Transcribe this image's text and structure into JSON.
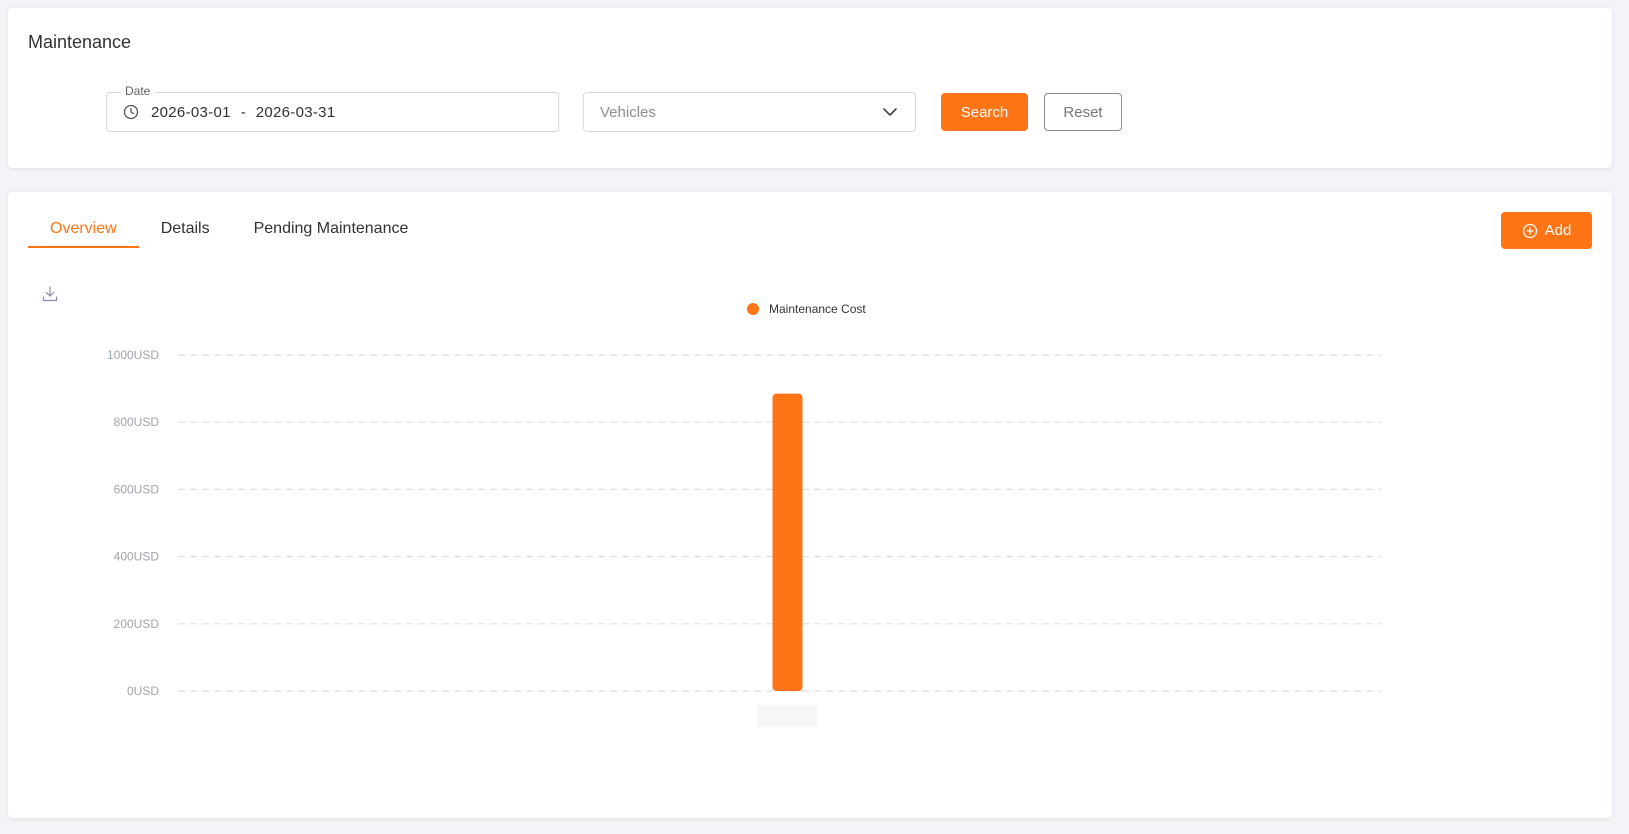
{
  "page_title": "Maintenance",
  "filters": {
    "date_label": "Date",
    "date_start": "2026-03-01",
    "date_separator": "-",
    "date_end": "2026-03-31",
    "vehicle_placeholder": "Vehicles",
    "search_label": "Search",
    "reset_label": "Reset"
  },
  "tabs": [
    {
      "label": "Overview",
      "active": true
    },
    {
      "label": "Details",
      "active": false
    },
    {
      "label": "Pending Maintenance",
      "active": false
    }
  ],
  "add_label": "Add",
  "icons": {
    "clock": "clock-icon",
    "chevron": "chevron-down-icon",
    "plus": "plus-circle-icon",
    "download": "download-icon"
  },
  "colors": {
    "accent": "#ff7415",
    "grid": "#dcdfe6",
    "axis_text": "#a0a4ad"
  },
  "chart_data": {
    "type": "bar",
    "categories": [
      ""
    ],
    "series": [
      {
        "name": "Maintenance Cost",
        "values": [
          885
        ]
      }
    ],
    "y_tick_labels": [
      "0USD",
      "200USD",
      "400USD",
      "600USD",
      "800USD",
      "1000USD"
    ],
    "y_ticks": [
      0,
      200,
      400,
      600,
      800,
      1000
    ],
    "ylim": [
      0,
      1000
    ],
    "grid": true,
    "legend": "top-center"
  }
}
